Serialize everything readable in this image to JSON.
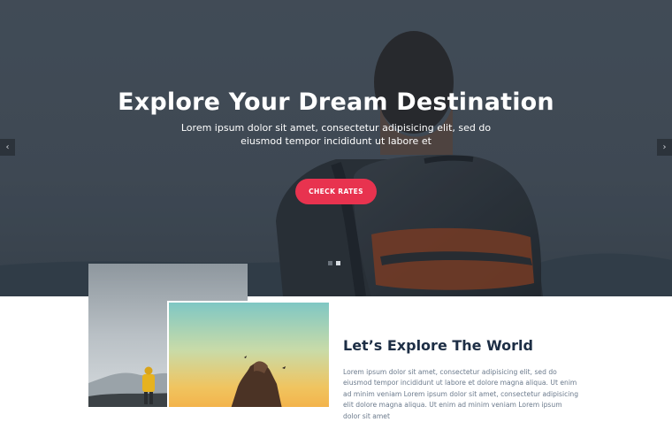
{
  "hero": {
    "title": "Explore Your Dream Destination",
    "subtitle": "Lorem ipsum dolor sit amet, consectetur adipisicing elit, sed do eiusmod tempor incididunt ut labore et",
    "button_label": "CHECK RATES",
    "arrow_prev": "‹",
    "arrow_next": "›",
    "slides_total": 2,
    "slide_active": 2
  },
  "about": {
    "title": "Let’s Explore The World",
    "text": "Lorem ipsum dolor sit amet, consectetur adipisicing elit, sed do eiusmod tempor incididunt ut labore et dolore magna aliqua. Ut enim ad minim veniam Lorem ipsum dolor sit amet, consectetur adipisicing elit dolore magna aliqua. Ut enim ad minim veniam Lorem ipsum dolor sit amet"
  },
  "colors": {
    "accent": "#e8334f",
    "heading": "#1d2e45",
    "body_text": "#6b7a8c"
  }
}
